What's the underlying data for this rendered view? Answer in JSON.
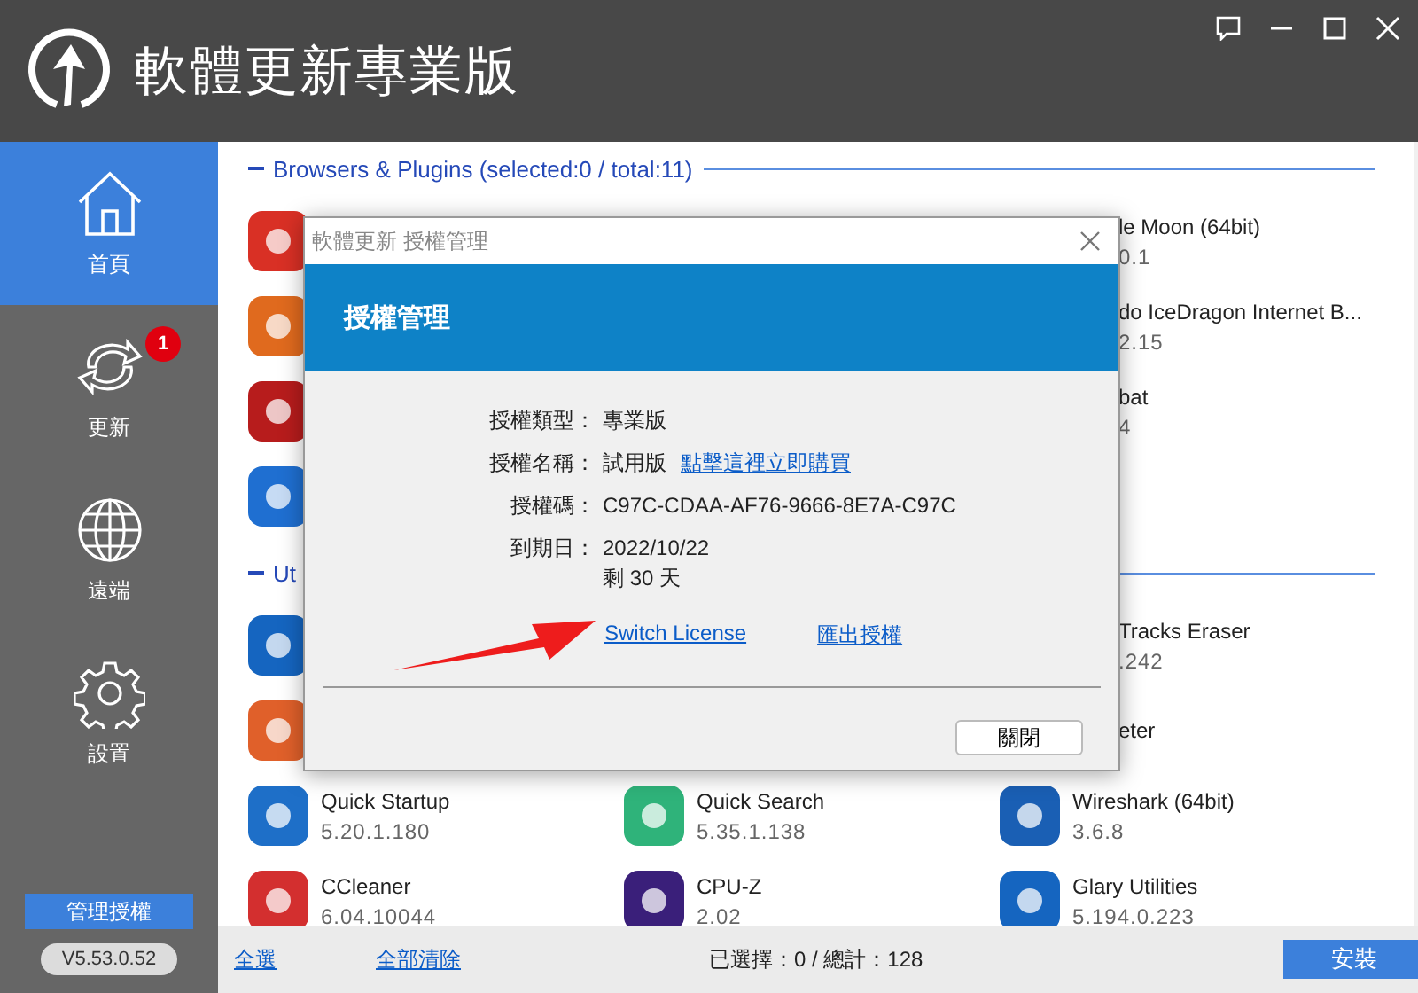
{
  "app": {
    "title": "軟體更新專業版"
  },
  "nav": [
    {
      "label": "首頁",
      "selected": true
    },
    {
      "label": "更新",
      "selected": false,
      "badge": "1"
    },
    {
      "label": "遠端",
      "selected": false
    },
    {
      "label": "設置",
      "selected": false
    }
  ],
  "license_button": "管理授權",
  "version": "V5.53.0.52",
  "sections": [
    {
      "title": "Browsers & Plugins (selected:0 / total:11)",
      "rows": [
        {
          "column_1": {
            "kind": "icon_only",
            "color": "#d93025"
          },
          "column_3": {
            "kind": "clipped",
            "name": "le Moon (64bit)",
            "version": "0.1"
          }
        },
        {
          "column_1": {
            "kind": "icon_only",
            "color": "#e06a1e"
          },
          "column_3": {
            "kind": "clipped",
            "name": "do IceDragon Internet B...",
            "version": "2.15"
          }
        },
        {
          "column_1": {
            "kind": "icon_only",
            "color": "#b71c1c"
          },
          "column_3": {
            "kind": "clipped",
            "name": "bat",
            "version": "4"
          }
        },
        {
          "column_1": {
            "kind": "icon_only",
            "color": "#1f6fd1"
          }
        }
      ]
    },
    {
      "title": "Ut",
      "rows": [
        {
          "column_1": {
            "kind": "icon_only",
            "color": "#1565c0"
          },
          "column_3": {
            "kind": "clipped",
            "name": "Tracks Eraser",
            "version": ".242"
          }
        },
        {
          "column_1": {
            "kind": "icon_only",
            "color": "#e0602a"
          },
          "column_3": {
            "kind": "clipped",
            "name": "eter"
          }
        },
        {
          "column_1": {
            "kind": "app",
            "color": "#1e6fc8",
            "name": "Quick Startup",
            "version": "5.20.1.180"
          },
          "column_2": {
            "kind": "app",
            "color": "#2fb37a",
            "name": "Quick Search",
            "version": "5.35.1.138"
          },
          "column_3": {
            "kind": "app",
            "color": "#1a5fb4",
            "name": "Wireshark (64bit)",
            "version": "3.6.8"
          }
        },
        {
          "column_1": {
            "kind": "app",
            "color": "#d32f2f",
            "name": "CCleaner",
            "version": "6.04.10044"
          },
          "column_2": {
            "kind": "app",
            "color": "#3a1f7a",
            "name": "CPU-Z",
            "version": "2.02"
          },
          "column_3": {
            "kind": "app",
            "color": "#1565c0",
            "name": "Glary Utilities",
            "version": "5.194.0.223"
          }
        }
      ]
    }
  ],
  "footer": {
    "select_all": "全選",
    "clear_all": "全部清除",
    "status": "已選擇：0 / 總計：128",
    "install": "安裝"
  },
  "dialog": {
    "title": "軟體更新 授權管理",
    "header": "授權管理",
    "fields": [
      {
        "label": "授權類型：",
        "lines": [
          "專業版"
        ]
      },
      {
        "label": "授權名稱：",
        "lines": [
          "試用版"
        ],
        "link": "點擊這裡立即購買"
      },
      {
        "label": "授權碼：",
        "lines": [
          "C97C-CDAA-AF76-9666-8E7A-C97C"
        ]
      },
      {
        "label": "到期日：",
        "lines": [
          "2022/10/22",
          "剩 30 天"
        ]
      }
    ],
    "links": [
      "Switch License",
      "匯出授權"
    ],
    "close": "關閉"
  }
}
